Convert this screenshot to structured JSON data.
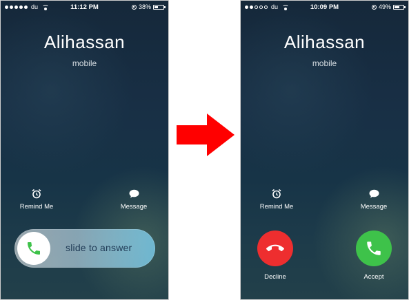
{
  "left_screen": {
    "status": {
      "carrier": "du",
      "time": "11:12 PM",
      "battery": "38%",
      "battery_level": 0.38,
      "signal_dots_filled": 5,
      "signal_dots_total": 5
    },
    "caller_name": "Alihassan",
    "caller_type": "mobile",
    "remind_label": "Remind Me",
    "message_label": "Message",
    "slide_text": "slide to answer"
  },
  "right_screen": {
    "status": {
      "carrier": "du",
      "time": "10:09 PM",
      "battery": "49%",
      "battery_level": 0.49,
      "signal_dots_filled": 2,
      "signal_dots_total": 5
    },
    "caller_name": "Alihassan",
    "caller_type": "mobile",
    "remind_label": "Remind Me",
    "message_label": "Message",
    "decline_label": "Decline",
    "accept_label": "Accept"
  },
  "colors": {
    "decline": "#ee2e2f",
    "accept": "#3ec24a",
    "arrow": "#ff0000",
    "phone_icon_green": "#3ec24a"
  },
  "icons": [
    "alarm-clock-icon",
    "speech-bubble-icon",
    "phone-handset-icon",
    "right-arrow-icon"
  ]
}
